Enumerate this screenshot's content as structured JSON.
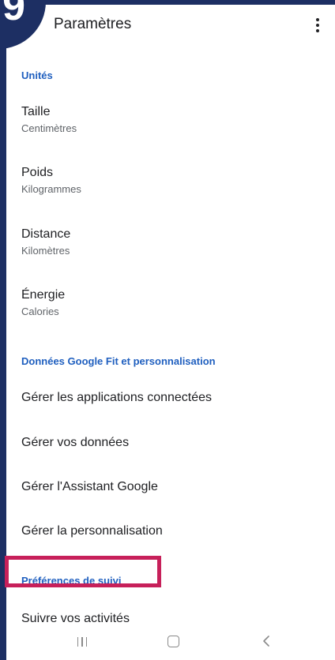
{
  "step": {
    "number": "9"
  },
  "appbar": {
    "title": "Paramètres",
    "more_icon": "more-vert-icon"
  },
  "sections": {
    "units": {
      "header": "Unités",
      "items": [
        {
          "title": "Taille",
          "value": "Centimètres"
        },
        {
          "title": "Poids",
          "value": "Kilogrammes"
        },
        {
          "title": "Distance",
          "value": "Kilomètres"
        },
        {
          "title": "Énergie",
          "value": "Calories"
        }
      ]
    },
    "data": {
      "header": "Données Google Fit et personnalisation",
      "items": [
        {
          "title": "Gérer les applications connectées"
        },
        {
          "title": "Gérer vos données"
        },
        {
          "title": "Gérer l'Assistant Google"
        },
        {
          "title": "Gérer la personnalisation"
        }
      ]
    },
    "tracking": {
      "header": "Préférences de suivi",
      "items": [
        {
          "title": "Suivre vos activités"
        }
      ]
    }
  },
  "navbar": {
    "recents_icon": "recents-icon",
    "home_icon": "home-icon",
    "back_icon": "back-icon"
  },
  "colors": {
    "frame": "#1d2f63",
    "accent": "#1f5fbf",
    "highlight": "#c7205a"
  }
}
